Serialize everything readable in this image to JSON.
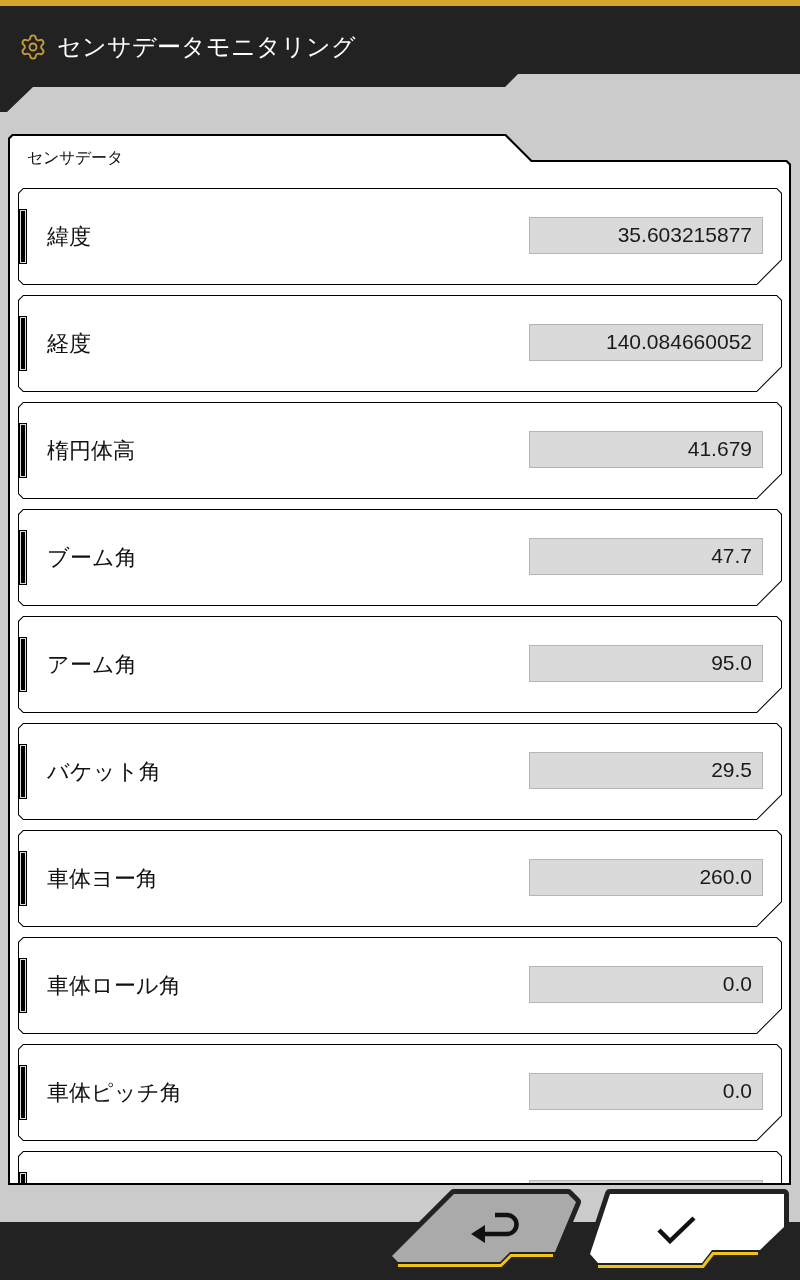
{
  "window": {
    "title": "センサデータモニタリング"
  },
  "panel": {
    "title": "センサデータ",
    "rows": [
      {
        "label": "緯度",
        "value": "35.603215877"
      },
      {
        "label": "経度",
        "value": "140.084660052"
      },
      {
        "label": "楕円体高",
        "value": "41.679"
      },
      {
        "label": "ブーム角",
        "value": "47.7"
      },
      {
        "label": "アーム角",
        "value": "95.0"
      },
      {
        "label": "バケット角",
        "value": "29.5"
      },
      {
        "label": "車体ヨー角",
        "value": "260.0"
      },
      {
        "label": "車体ロール角",
        "value": "0.0"
      },
      {
        "label": "車体ピッチ角",
        "value": "0.0"
      }
    ]
  }
}
